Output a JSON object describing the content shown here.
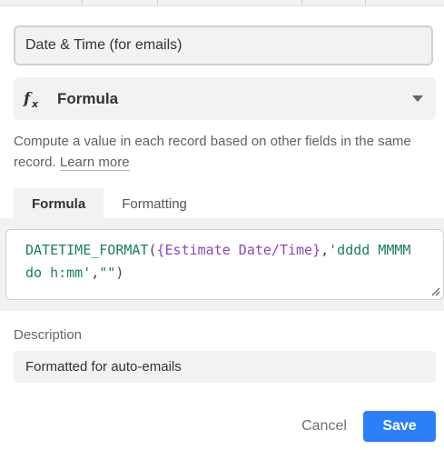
{
  "field": {
    "name": "Date & Time (for emails)",
    "type_label": "Formula",
    "type_icon": "formula-fx-icon"
  },
  "description_text": "Compute a value in each record based on other fields in the same record.",
  "learn_more": "Learn more",
  "tabs": [
    {
      "label": "Formula",
      "active": true
    },
    {
      "label": "Formatting",
      "active": false
    }
  ],
  "formula": {
    "fn": "DATETIME_FORMAT",
    "open": "(",
    "field_ref": "{Estimate Date/Time}",
    "comma1": ",",
    "str1": "'dddd MMMM do h:mm'",
    "comma2": ",",
    "str2": "\"\"",
    "close": ")"
  },
  "field_description": {
    "label": "Description",
    "value": "Formatted for auto-emails"
  },
  "buttons": {
    "cancel": "Cancel",
    "save": "Save"
  },
  "colors": {
    "primary": "#2d7ff9",
    "function": "#19805c",
    "field_ref": "#8e44c4"
  }
}
